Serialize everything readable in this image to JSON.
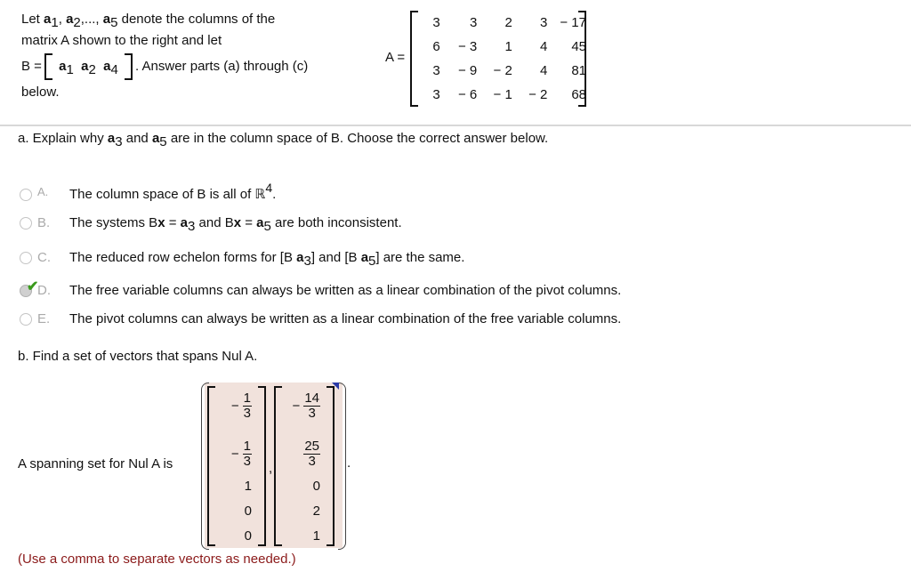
{
  "intro": {
    "let": "Let",
    "a": "a",
    "sub1": "1",
    "sub2": "2",
    "sub4": "4",
    "sub5": "5",
    "sep1": ",",
    "sep2": ",...,",
    "denote": "denote the columns of the",
    "line2": "matrix A shown to the right and let",
    "b_eq": "B =",
    "answer_parts": ". Answer parts (a) through (c)",
    "below": "below."
  },
  "matrix_a": {
    "label": "A =",
    "rows": [
      [
        "3",
        "3",
        "2",
        "3",
        "− 17"
      ],
      [
        "6",
        "− 3",
        "1",
        "4",
        "45"
      ],
      [
        "3",
        "− 9",
        "− 2",
        "4",
        "81"
      ],
      [
        "3",
        "− 6",
        "− 1",
        "− 2",
        "68"
      ]
    ]
  },
  "part_a": {
    "prefix": "a. Explain why",
    "a": "a",
    "sub3": "3",
    "and": "and",
    "sub5": "5",
    "suffix": "are in the column space of B. Choose the correct answer below.",
    "options": [
      {
        "letter": "A.",
        "text": "The column space of B is all of ℝ",
        "sup": "4",
        "end": ".",
        "selected": false
      },
      {
        "letter": "B.",
        "t1": "The systems B",
        "x": "x",
        "eq": " = ",
        "a": "a",
        "s1": "3",
        "t2": " and B",
        "s2": "5",
        "t3": " are both inconsistent.",
        "selected": false
      },
      {
        "letter": "C.",
        "t1": "The reduced row echelon forms for [B ",
        "a": "a",
        "s1": "3",
        "t2": "] and [B ",
        "s2": "5",
        "t3": "] are the same.",
        "selected": false
      },
      {
        "letter": "D.",
        "text": "The free variable columns can always be written as a linear combination of the pivot columns.",
        "selected": true,
        "status": "correct"
      },
      {
        "letter": "E.",
        "text": "The pivot columns can always be written as a linear combination of the free variable columns.",
        "selected": false
      }
    ]
  },
  "part_b": {
    "prompt": "b. Find a set of vectors that spans Nul A.",
    "answer_label": "A spanning set for Nul A is",
    "comma": ",",
    "period": ".",
    "vectors": [
      [
        {
          "neg": "−",
          "num": "1",
          "den": "3"
        },
        {
          "neg": "−",
          "num": "1",
          "den": "3"
        },
        {
          "v": "1"
        },
        {
          "v": "0"
        },
        {
          "v": "0"
        }
      ],
      [
        {
          "neg": "−",
          "num": "14",
          "den": "3"
        },
        {
          "neg": "",
          "num": "25",
          "den": "3"
        },
        {
          "v": "0"
        },
        {
          "v": "2"
        },
        {
          "v": "1"
        }
      ]
    ],
    "hint": "(Use a comma to separate vectors as needed.)"
  },
  "colors": {
    "answer_bg": "#f1e2dc",
    "hint": "#8b1a1a",
    "check": "#3a9a1c",
    "letter_gray": "#aaaaaa"
  }
}
